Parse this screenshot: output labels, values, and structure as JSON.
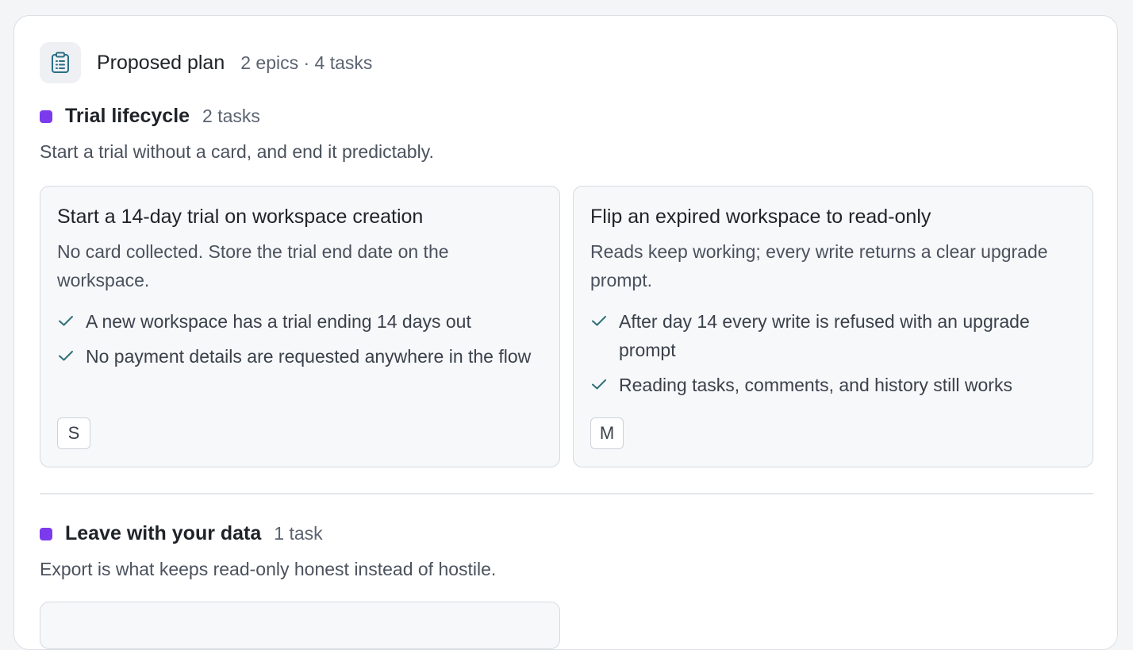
{
  "plan": {
    "title": "Proposed plan",
    "meta": "2 epics · 4 tasks",
    "icon": "clipboard-list-icon"
  },
  "colors": {
    "epic_dot": "#7c3aed",
    "check": "#2f6f7a",
    "icon_accent": "#2a6f86"
  },
  "epics": [
    {
      "title": "Trial lifecycle",
      "count": "2 tasks",
      "description": "Start a trial without a card, and end it predictably.",
      "tasks": [
        {
          "title": "Start a 14-day trial on workspace creation",
          "description": "No card collected. Store the trial end date on the workspace.",
          "criteria": [
            "A new workspace has a trial ending 14 days out",
            "No payment details are requested anywhere in the flow"
          ],
          "size": "S"
        },
        {
          "title": "Flip an expired workspace to read-only",
          "description": "Reads keep working; every write returns a clear upgrade prompt.",
          "criteria": [
            "After day 14 every write is refused with an upgrade prompt",
            "Reading tasks, comments, and history still works"
          ],
          "size": "M"
        }
      ]
    },
    {
      "title": "Leave with your data",
      "count": "1 task",
      "description": "Export is what keeps read-only honest instead of hostile."
    }
  ]
}
